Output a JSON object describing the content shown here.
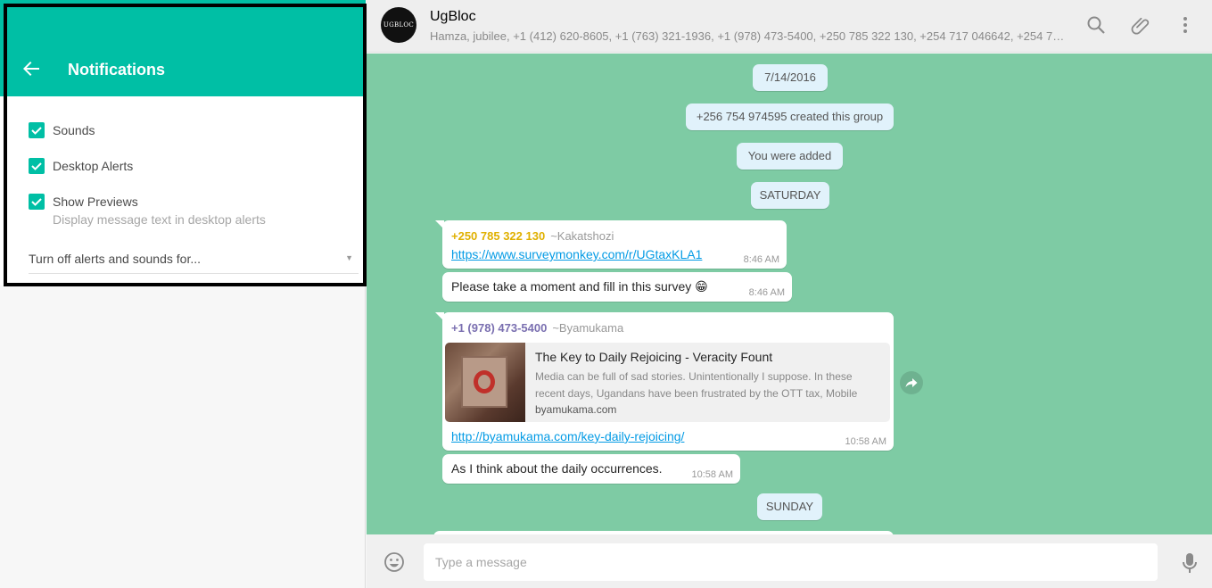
{
  "notifications": {
    "title": "Notifications",
    "options": [
      {
        "label": "Sounds",
        "checked": true
      },
      {
        "label": "Desktop Alerts",
        "checked": true
      },
      {
        "label": "Show Previews",
        "checked": true,
        "sublabel": "Display message text in desktop alerts"
      }
    ],
    "mute_select": {
      "label": "Turn off alerts and sounds for..."
    }
  },
  "chat": {
    "group_name": "UgBloc",
    "members": "Hamza, jubilee, +1 (412) 620-8605, +1 (763) 321-1936, +1 (978) 473-5400, +250 785 322 130, +254 717 046642, +254 72...",
    "avatar_text": "UGBLOC",
    "header_icons": [
      "search-icon",
      "attach-icon",
      "menu-icon"
    ],
    "system_messages": [
      "7/14/2016",
      "+256 754 974595 created this group",
      "You were added",
      "SATURDAY",
      "SUNDAY"
    ],
    "messages": [
      {
        "sender_number": "+250 785 322 130",
        "sender_name": "~Kakatshozi",
        "sender_color": "#e0b000",
        "link": "https://www.surveymonkey.com/r/UGtaxKLA1",
        "time": "8:46 AM"
      },
      {
        "text": "Please take a moment and fill in this survey 😁",
        "time": "8:46 AM"
      },
      {
        "sender_number": "+1 (978) 473-5400",
        "sender_name": "~Byamukama",
        "sender_color": "#7a6fb0",
        "preview": {
          "title": "The Key to Daily Rejoicing - Veracity Fount",
          "description": "Media can be full of sad stories. Unintentionally I suppose. In these recent days, Ugandans have been frustrated by the OTT tax, Mobile",
          "domain": "byamukama.com"
        },
        "link": "http://byamukama.com/key-daily-rejoicing/",
        "time": "10:58 AM"
      },
      {
        "text": "As I think about the daily occurrences.",
        "time": "10:58 AM"
      }
    ],
    "composer": {
      "placeholder": "Type a message"
    }
  },
  "colors": {
    "accent": "#00bfa5",
    "chat_background": "#7ecba4",
    "system_bubble": "#e1f2fb"
  }
}
